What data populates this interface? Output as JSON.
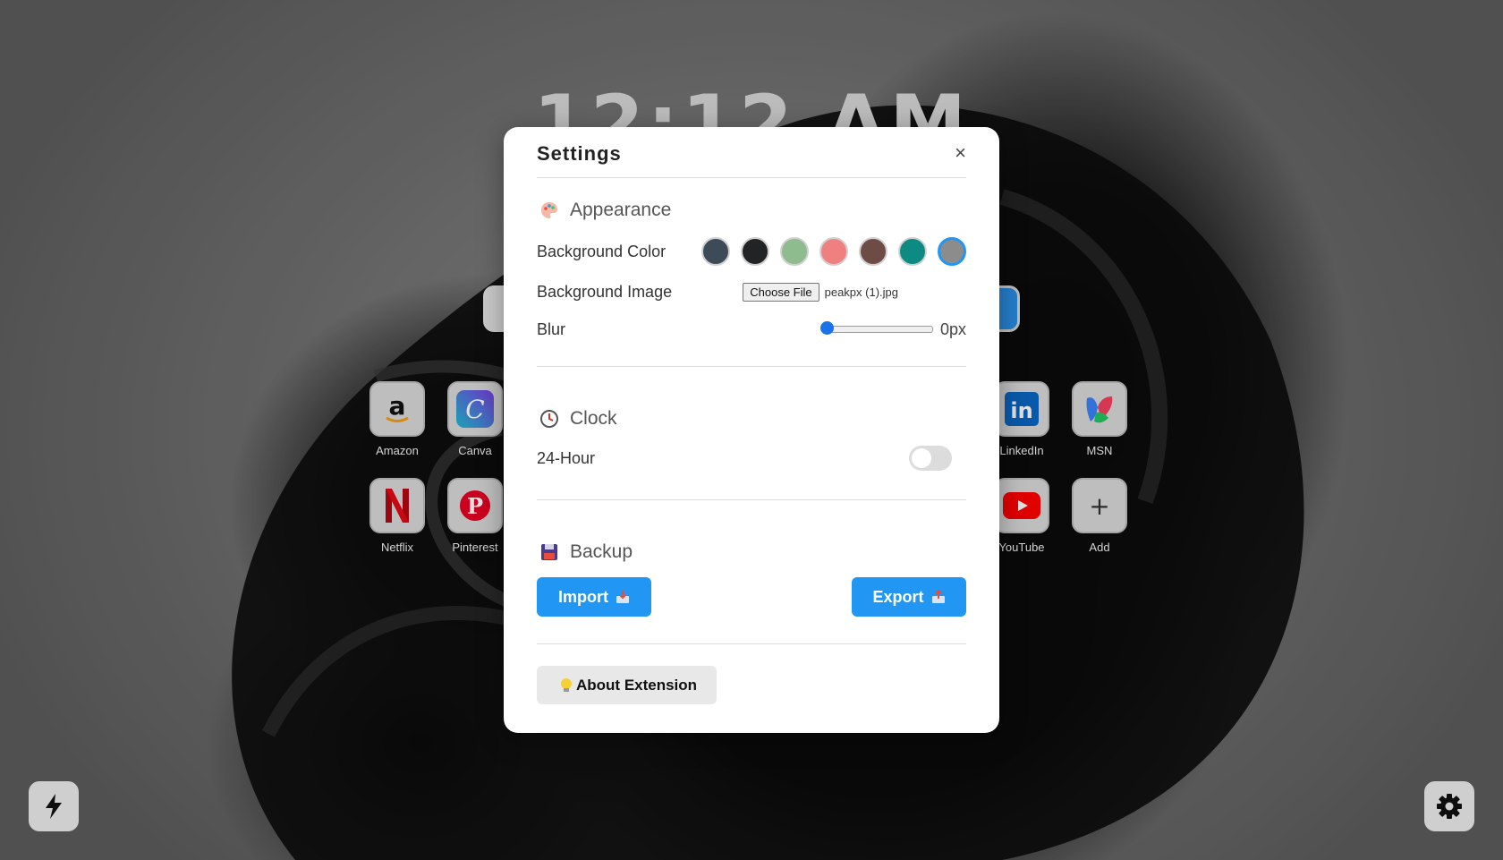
{
  "clock": {
    "time": "12:12 AM"
  },
  "shortcuts": [
    {
      "label": "Amazon",
      "icon": "amazon-icon"
    },
    {
      "label": "Canva",
      "icon": "canva-icon"
    },
    {
      "label": "LinkedIn",
      "icon": "linkedin-icon"
    },
    {
      "label": "MSN",
      "icon": "msn-icon"
    },
    {
      "label": "Netflix",
      "icon": "netflix-icon"
    },
    {
      "label": "Pinterest",
      "icon": "pinterest-icon"
    },
    {
      "label": "YouTube",
      "icon": "youtube-icon"
    },
    {
      "label": "Add",
      "icon": "plus-icon"
    }
  ],
  "settings": {
    "title": "Settings",
    "close": "×",
    "appearance": {
      "heading": "Appearance",
      "bg_color_label": "Background Color",
      "swatches": [
        "#3d4a57",
        "#222325",
        "#8fbc8f",
        "#f08080",
        "#6d4c45",
        "#0d8a82",
        "#8c8c8c"
      ],
      "selected_swatch": "#8c8c8c",
      "bg_image_label": "Background Image",
      "file_button": "Choose File",
      "file_name": "peakpx (1).jpg",
      "blur_label": "Blur",
      "blur_value": "0px"
    },
    "clock": {
      "heading": "Clock",
      "hour24_label": "24-Hour",
      "hour24_on": false
    },
    "backup": {
      "heading": "Backup",
      "import_label": "Import",
      "export_label": "Export"
    },
    "about_label": "About Extension"
  },
  "colors": {
    "accent": "#2196f3"
  }
}
